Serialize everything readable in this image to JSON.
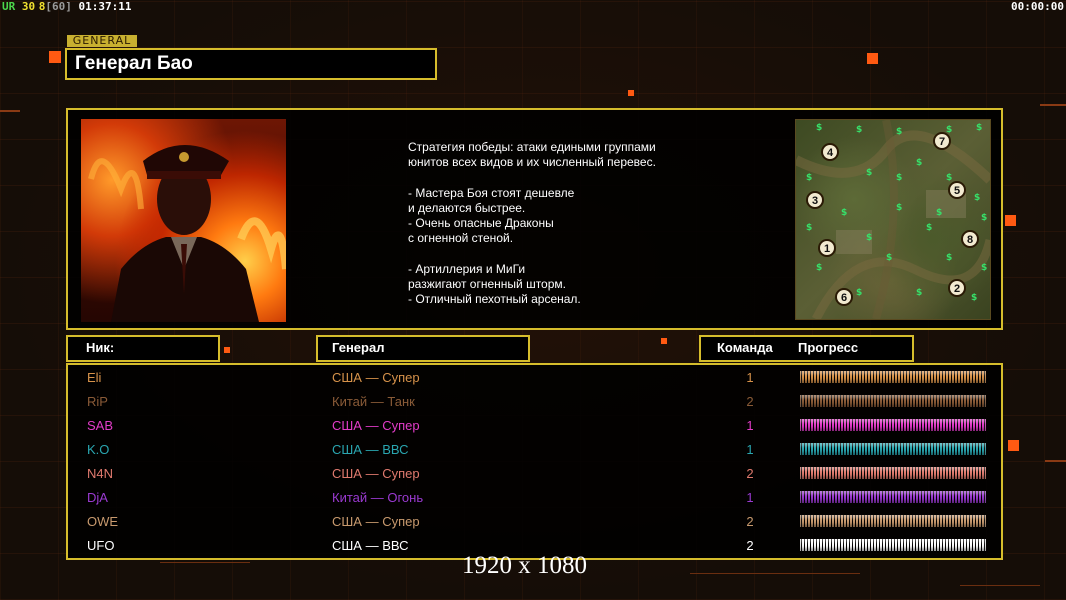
{
  "hud": {
    "ur_label": "UR",
    "fps_value": "30",
    "fps_min": "8",
    "fps_cap": "[60]",
    "clock": "01:37:11",
    "timer": "00:00:00"
  },
  "header": {
    "tag": "GENERAL",
    "title": "Генерал Бао"
  },
  "description": "Стратегия победы: атаки едиными группами\nюнитов всех видов и их численный перевес.\n\n- Мастера Боя стоят дешевле\nи делаются быстрее.\n- Очень опасные Драконы\nс огненной стеной.\n\n- Артиллерия и МиГи\nразжигают огненный шторм.\n- Отличный пехотный арсенал.",
  "map": {
    "start_positions": [
      "1",
      "2",
      "3",
      "4",
      "5",
      "6",
      "7",
      "8"
    ]
  },
  "columns": {
    "nick": "Ник:",
    "general": "Генерал",
    "team": "Команда",
    "progress": "Прогресс"
  },
  "players": [
    {
      "nick": "Eli",
      "general": "США — Супер",
      "team": "1",
      "color": "#d6924a",
      "progress": 1.0
    },
    {
      "nick": "RiP",
      "general": "Китай — Танк",
      "team": "2",
      "color": "#8a5b37",
      "progress": 1.0
    },
    {
      "nick": "SAB",
      "general": "США — Супер",
      "team": "1",
      "color": "#e23cc8",
      "progress": 1.0
    },
    {
      "nick": "K.O",
      "general": "США — ВВС",
      "team": "1",
      "color": "#2aa6b0",
      "progress": 1.0
    },
    {
      "nick": "N4N",
      "general": "США — Супер",
      "team": "2",
      "color": "#e07a6e",
      "progress": 1.0
    },
    {
      "nick": "DjA",
      "general": "Китай — Огонь",
      "team": "1",
      "color": "#9a3ad0",
      "progress": 1.0
    },
    {
      "nick": "OWE",
      "general": "США — Супер",
      "team": "2",
      "color": "#c89a6e",
      "progress": 1.0
    },
    {
      "nick": "UFO",
      "general": "США — ВВС",
      "team": "2",
      "color": "#ffffff",
      "progress": 1.0
    }
  ],
  "resolution": "1920 x 1080",
  "colors": {
    "frame": "#d6bd2c",
    "accent": "#ff5a12"
  }
}
